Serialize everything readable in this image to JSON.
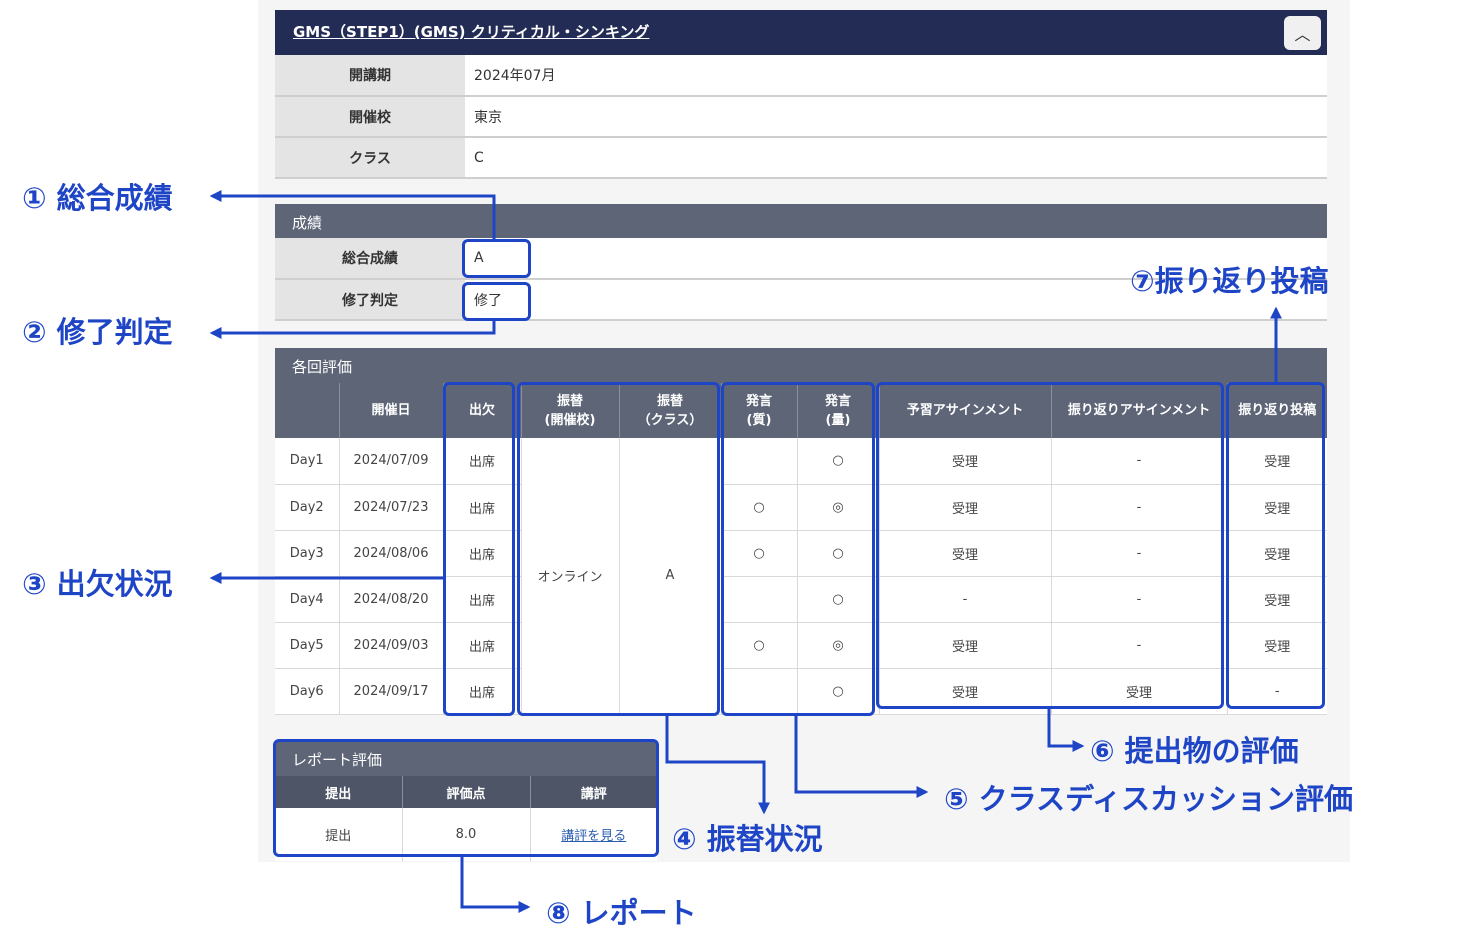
{
  "course": {
    "title": "GMS（STEP1）(GMS) クリティカル・シンキング",
    "collapse_icon": "chevron-up-icon",
    "collapse_glyph": "︿",
    "info": [
      {
        "label": "開講期",
        "value": "2024年07月"
      },
      {
        "label": "開催校",
        "value": "東京"
      },
      {
        "label": "クラス",
        "value": "C"
      }
    ]
  },
  "grades": {
    "section_title": "成績",
    "rows": [
      {
        "label": "総合成績",
        "value": "A"
      },
      {
        "label": "修了判定",
        "value": "修了"
      }
    ]
  },
  "sessions": {
    "section_title": "各回評価",
    "headers": {
      "day": "",
      "date": "開催日",
      "attendance": "出欠",
      "transfer_campus_1": "振替",
      "transfer_campus_2": "(開催校)",
      "transfer_class_1": "振替",
      "transfer_class_2": "（クラス）",
      "speak_quality_1": "発言",
      "speak_quality_2": "(質)",
      "speak_quantity_1": "発言",
      "speak_quantity_2": "(量)",
      "prep_assignment": "予習アサインメント",
      "review_assignment": "振り返りアサインメント",
      "review_post": "振り返り投稿"
    },
    "transfer_campus_value": "オンライン",
    "transfer_class_value": "A",
    "rows": [
      {
        "day": "Day1",
        "date": "2024/07/09",
        "attendance": "出席",
        "quality": "",
        "quantity": "○",
        "prep": "受理",
        "review": "-",
        "post": "受理"
      },
      {
        "day": "Day2",
        "date": "2024/07/23",
        "attendance": "出席",
        "quality": "○",
        "quantity": "◎",
        "prep": "受理",
        "review": "-",
        "post": "受理"
      },
      {
        "day": "Day3",
        "date": "2024/08/06",
        "attendance": "出席",
        "quality": "○",
        "quantity": "○",
        "prep": "受理",
        "review": "-",
        "post": "受理"
      },
      {
        "day": "Day4",
        "date": "2024/08/20",
        "attendance": "出席",
        "quality": "",
        "quantity": "○",
        "prep": "-",
        "review": "-",
        "post": "受理"
      },
      {
        "day": "Day5",
        "date": "2024/09/03",
        "attendance": "出席",
        "quality": "○",
        "quantity": "◎",
        "prep": "受理",
        "review": "-",
        "post": "受理"
      },
      {
        "day": "Day6",
        "date": "2024/09/17",
        "attendance": "出席",
        "quality": "",
        "quantity": "○",
        "prep": "受理",
        "review": "受理",
        "post": "-"
      }
    ]
  },
  "report": {
    "section_title": "レポート評価",
    "headers": {
      "submit": "提出",
      "score": "評価点",
      "review": "講評"
    },
    "row": {
      "submit": "提出",
      "score": "8.0",
      "review_link": "講評を見る"
    }
  },
  "annotations": {
    "a1": "① 総合成績",
    "a2": "② 修了判定",
    "a3": "③ 出欠状況",
    "a4": "④ 振替状況",
    "a5": "⑤ クラスディスカッション評価",
    "a6": "⑥ 提出物の評価",
    "a7": "⑦振り返り投稿",
    "a8": "⑧ レポート"
  },
  "colors": {
    "annotation": "#1f45c7",
    "header_dark": "#232c55",
    "section_bar": "#5e6577"
  }
}
